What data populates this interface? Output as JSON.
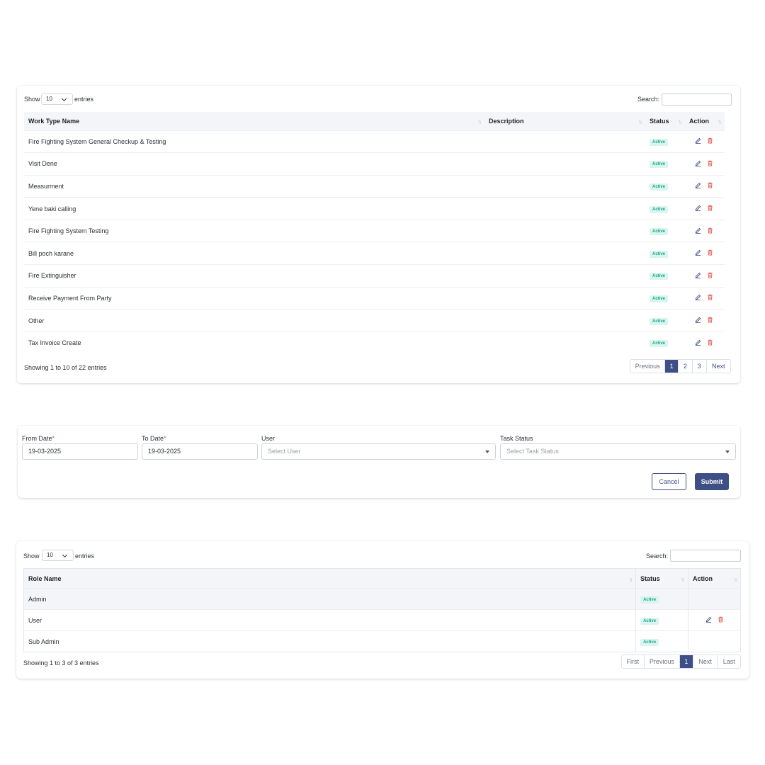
{
  "work_table": {
    "show_label": "Show",
    "entries_value": "10",
    "entries_label": "entries",
    "search_label": "Search:",
    "columns": [
      "Work Type Name",
      "Description",
      "Status",
      "Action"
    ],
    "rows": [
      {
        "name": "Fire Fighting System General Checkup & Testing",
        "status": "Active"
      },
      {
        "name": "Visit Dene",
        "status": "Active"
      },
      {
        "name": "Measurment",
        "status": "Active"
      },
      {
        "name": "Yene baki calling",
        "status": "Active"
      },
      {
        "name": "Fire Fighting System Testing",
        "status": "Active"
      },
      {
        "name": "Bill poch karane",
        "status": "Active"
      },
      {
        "name": "Fire Extinguisher",
        "status": "Active"
      },
      {
        "name": "Receive Payment From Party",
        "status": "Active"
      },
      {
        "name": "Other",
        "status": "Active"
      },
      {
        "name": "Tax Invoice Create",
        "status": "Active"
      }
    ],
    "info": "Showing 1 to 10 of 22 entries",
    "pager": {
      "previous": "Previous",
      "pages": [
        "1",
        "2",
        "3"
      ],
      "next": "Next"
    }
  },
  "filter_form": {
    "from_date_label": "From Date",
    "from_date_value": "19-03-2025",
    "to_date_label": "To Date",
    "to_date_value": "19-03-2025",
    "required_mark": "*",
    "user_label": "User",
    "user_placeholder": "Select User",
    "task_status_label": "Task Status",
    "task_status_placeholder": "Select Task Status",
    "cancel_label": "Cancel",
    "submit_label": "Submit"
  },
  "role_table": {
    "show_label": "Show",
    "entries_value": "10",
    "entries_label": "entries",
    "search_label": "Search:",
    "columns": [
      "Role Name",
      "Status",
      "Action"
    ],
    "rows": [
      {
        "name": "Admin",
        "status": "Active"
      },
      {
        "name": "User",
        "status": "Active"
      },
      {
        "name": "Sub Admin",
        "status": "Active"
      }
    ],
    "info": "Showing 1 to 3 of 3 entries",
    "pager": {
      "first": "First",
      "previous": "Previous",
      "page": "1",
      "next": "Next",
      "last": "Last"
    }
  },
  "colors": {
    "primary": "#3e4f86",
    "badge_bg": "#d8f5ef",
    "badge_text": "#1aa58a",
    "delete": "#e0584f"
  },
  "icons": {
    "edit": "pencil-icon",
    "delete": "trash-icon",
    "sort": "sort-icon"
  }
}
